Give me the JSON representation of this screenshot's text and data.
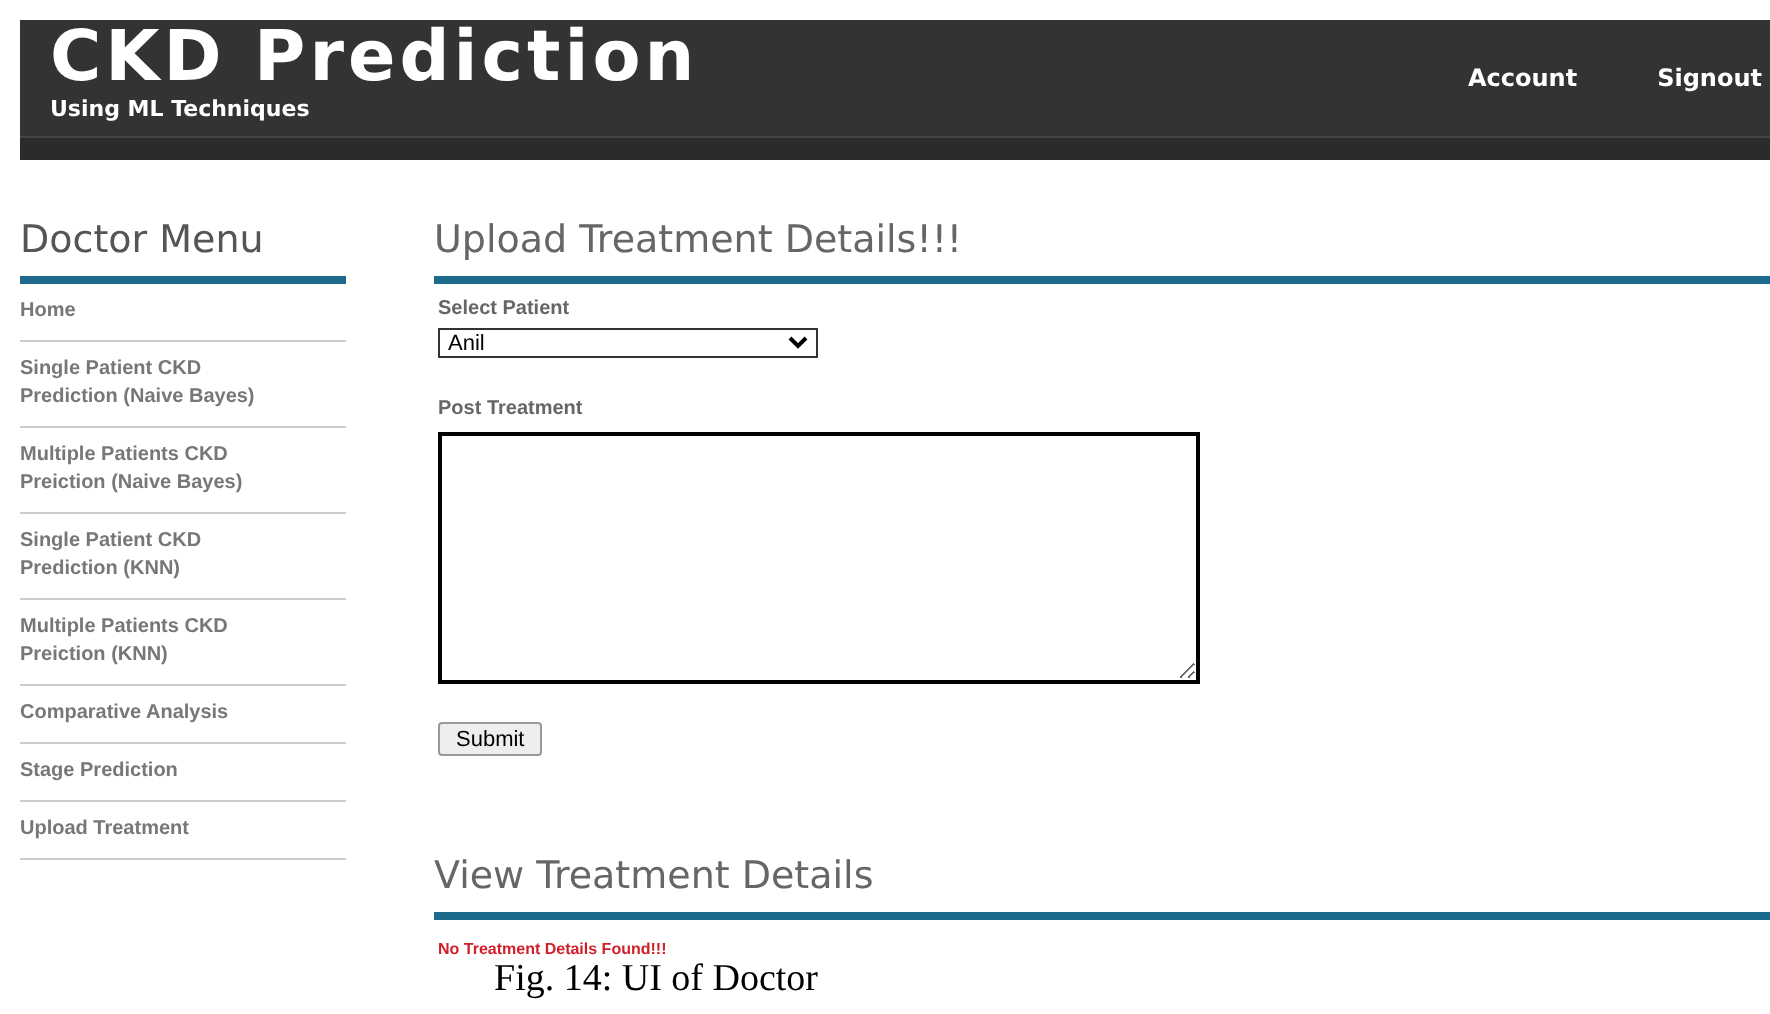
{
  "header": {
    "title": "CKD Prediction",
    "subtitle": "Using ML Techniques",
    "nav": [
      "Account",
      "Signout"
    ]
  },
  "sidebar": {
    "title": "Doctor Menu",
    "items": [
      {
        "label": "Home"
      },
      {
        "label": "Single Patient CKD Prediction (Naive Bayes)"
      },
      {
        "label": "Multiple Patients CKD Preiction (Naive Bayes)"
      },
      {
        "label": "Single Patient CKD Prediction (KNN)"
      },
      {
        "label": "Multiple Patients CKD Preiction (KNN)"
      },
      {
        "label": "Comparative Analysis"
      },
      {
        "label": "Stage Prediction"
      },
      {
        "label": "Upload Treatment"
      }
    ]
  },
  "upload": {
    "title": "Upload Treatment Details!!!",
    "patient_label": "Select Patient",
    "patient_value": "Anil",
    "treatment_label": "Post Treatment",
    "submit": "Submit"
  },
  "view": {
    "title": "View Treatment Details",
    "message": "No Treatment Details Found!!!"
  },
  "caption": "Fig. 14: UI of Doctor"
}
